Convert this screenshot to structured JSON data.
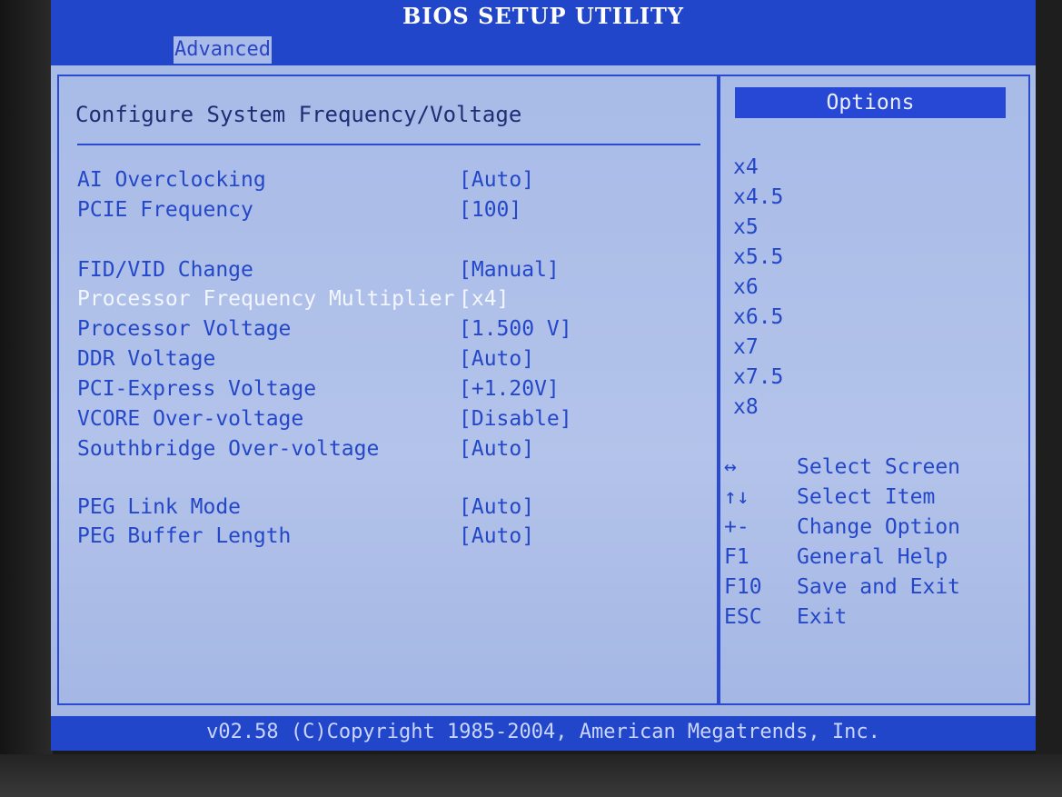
{
  "title": "BIOS SETUP UTILITY",
  "menu": {
    "active_tab": "Advanced"
  },
  "panel": {
    "heading": "Configure System Frequency/Voltage",
    "settings": [
      {
        "label": "AI Overclocking",
        "value": "[Auto]"
      },
      {
        "label": "PCIE Frequency",
        "value": "[100]"
      },
      {
        "label": "FID/VID Change",
        "value": "[Manual]"
      },
      {
        "label": "Processor Frequency Multiplier",
        "value": "[x4]",
        "selected": true
      },
      {
        "label": "Processor Voltage",
        "value": "[1.500 V]"
      },
      {
        "label": "DDR Voltage",
        "value": "[Auto]"
      },
      {
        "label": "PCI-Express Voltage",
        "value": "[+1.20V]"
      },
      {
        "label": "VCORE Over-voltage",
        "value": "[Disable]"
      },
      {
        "label": "Southbridge Over-voltage",
        "value": "[Auto]"
      },
      {
        "label": "PEG Link Mode",
        "value": "[Auto]"
      },
      {
        "label": "PEG Buffer Length",
        "value": "[Auto]"
      }
    ]
  },
  "options": {
    "header": "Options",
    "items": [
      "x4",
      "x4.5",
      "x5",
      "x5.5",
      "x6",
      "x6.5",
      "x7",
      "x7.5",
      "x8"
    ]
  },
  "help": [
    {
      "key": "↔",
      "desc": "Select Screen"
    },
    {
      "key": "↑↓",
      "desc": "Select Item"
    },
    {
      "key": "+-",
      "desc": "Change Option"
    },
    {
      "key": "F1",
      "desc": "General Help"
    },
    {
      "key": "F10",
      "desc": "Save and Exit"
    },
    {
      "key": "ESC",
      "desc": "Exit"
    }
  ],
  "footer": "v02.58 (C)Copyright 1985-2004, American Megatrends, Inc.",
  "colors": {
    "bar_blue": "#2246c9",
    "panel_bg": "#a6b9e6",
    "text_blue": "#2347c8",
    "highlight_text": "#f3f6ff"
  }
}
